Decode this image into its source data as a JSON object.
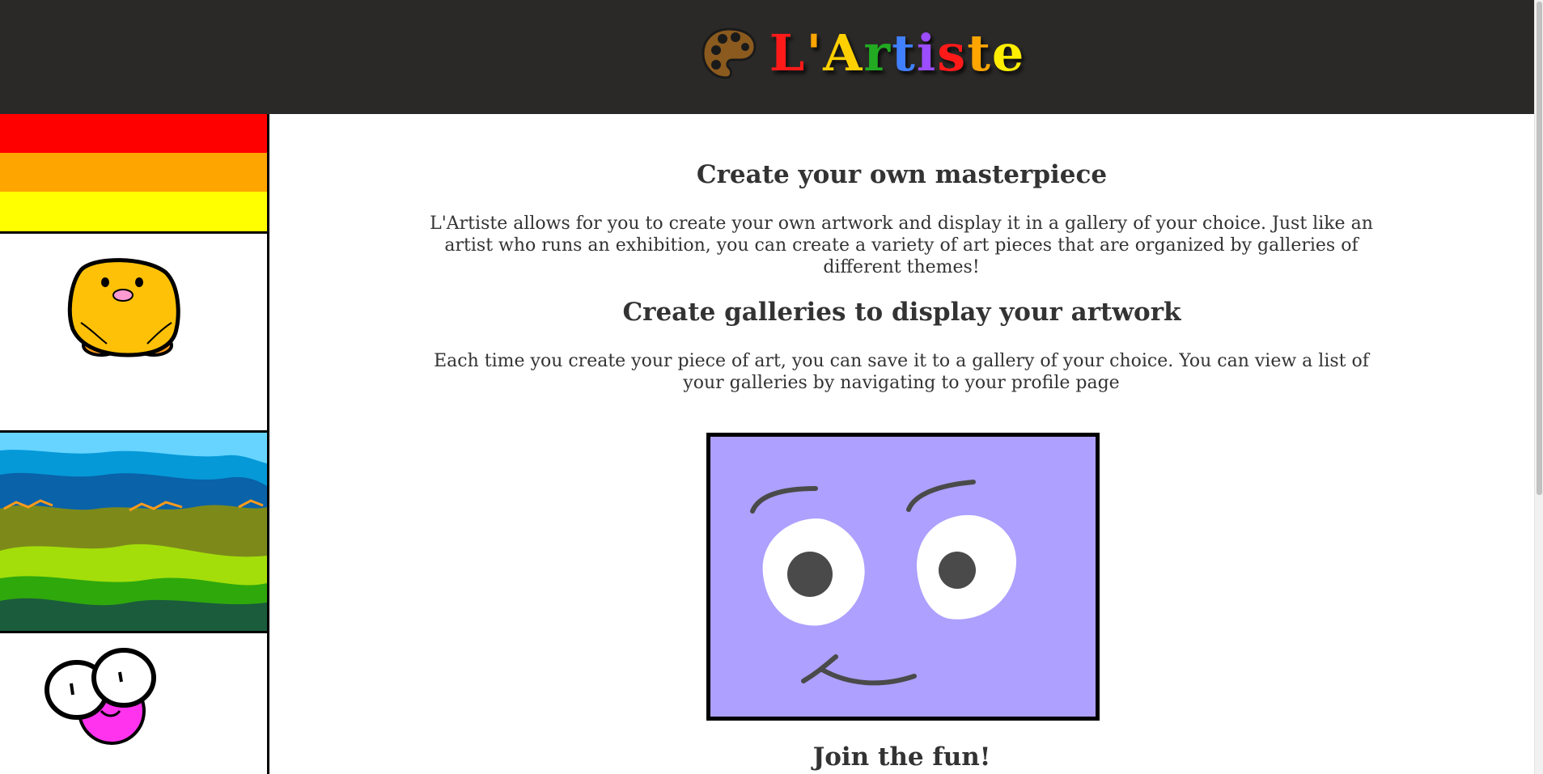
{
  "header": {
    "palette_icon": "palette-icon",
    "title_letters": [
      {
        "char": "L",
        "color": "#ff1a1a"
      },
      {
        "char": "'",
        "color": "#ffa500"
      },
      {
        "char": "A",
        "color": "#ffd000"
      },
      {
        "char": "r",
        "color": "#22aa22"
      },
      {
        "char": "t",
        "color": "#4080ff"
      },
      {
        "char": "i",
        "color": "#9b4dff"
      },
      {
        "char": "s",
        "color": "#ff1a1a"
      },
      {
        "char": "t",
        "color": "#ffa500"
      },
      {
        "char": "e",
        "color": "#ffee00"
      }
    ]
  },
  "main": {
    "section1_title": "Create your own masterpiece",
    "section1_text": "L'Artiste allows for you to create your own artwork and display it in a gallery of your choice. Just like an artist who runs an exhibition, you can create a variety of art pieces that are organized by galleries of different themes!",
    "section2_title": "Create galleries to display your artwork",
    "section2_text": "Each time you create your piece of art, you can save it to a gallery of your choice. You can view a list of your galleries by navigating to your profile page",
    "section3_title": "Join the fun!"
  },
  "colors": {
    "header_bg": "#2a2928",
    "featured_bg": "#ada0fe",
    "text": "#333333"
  }
}
